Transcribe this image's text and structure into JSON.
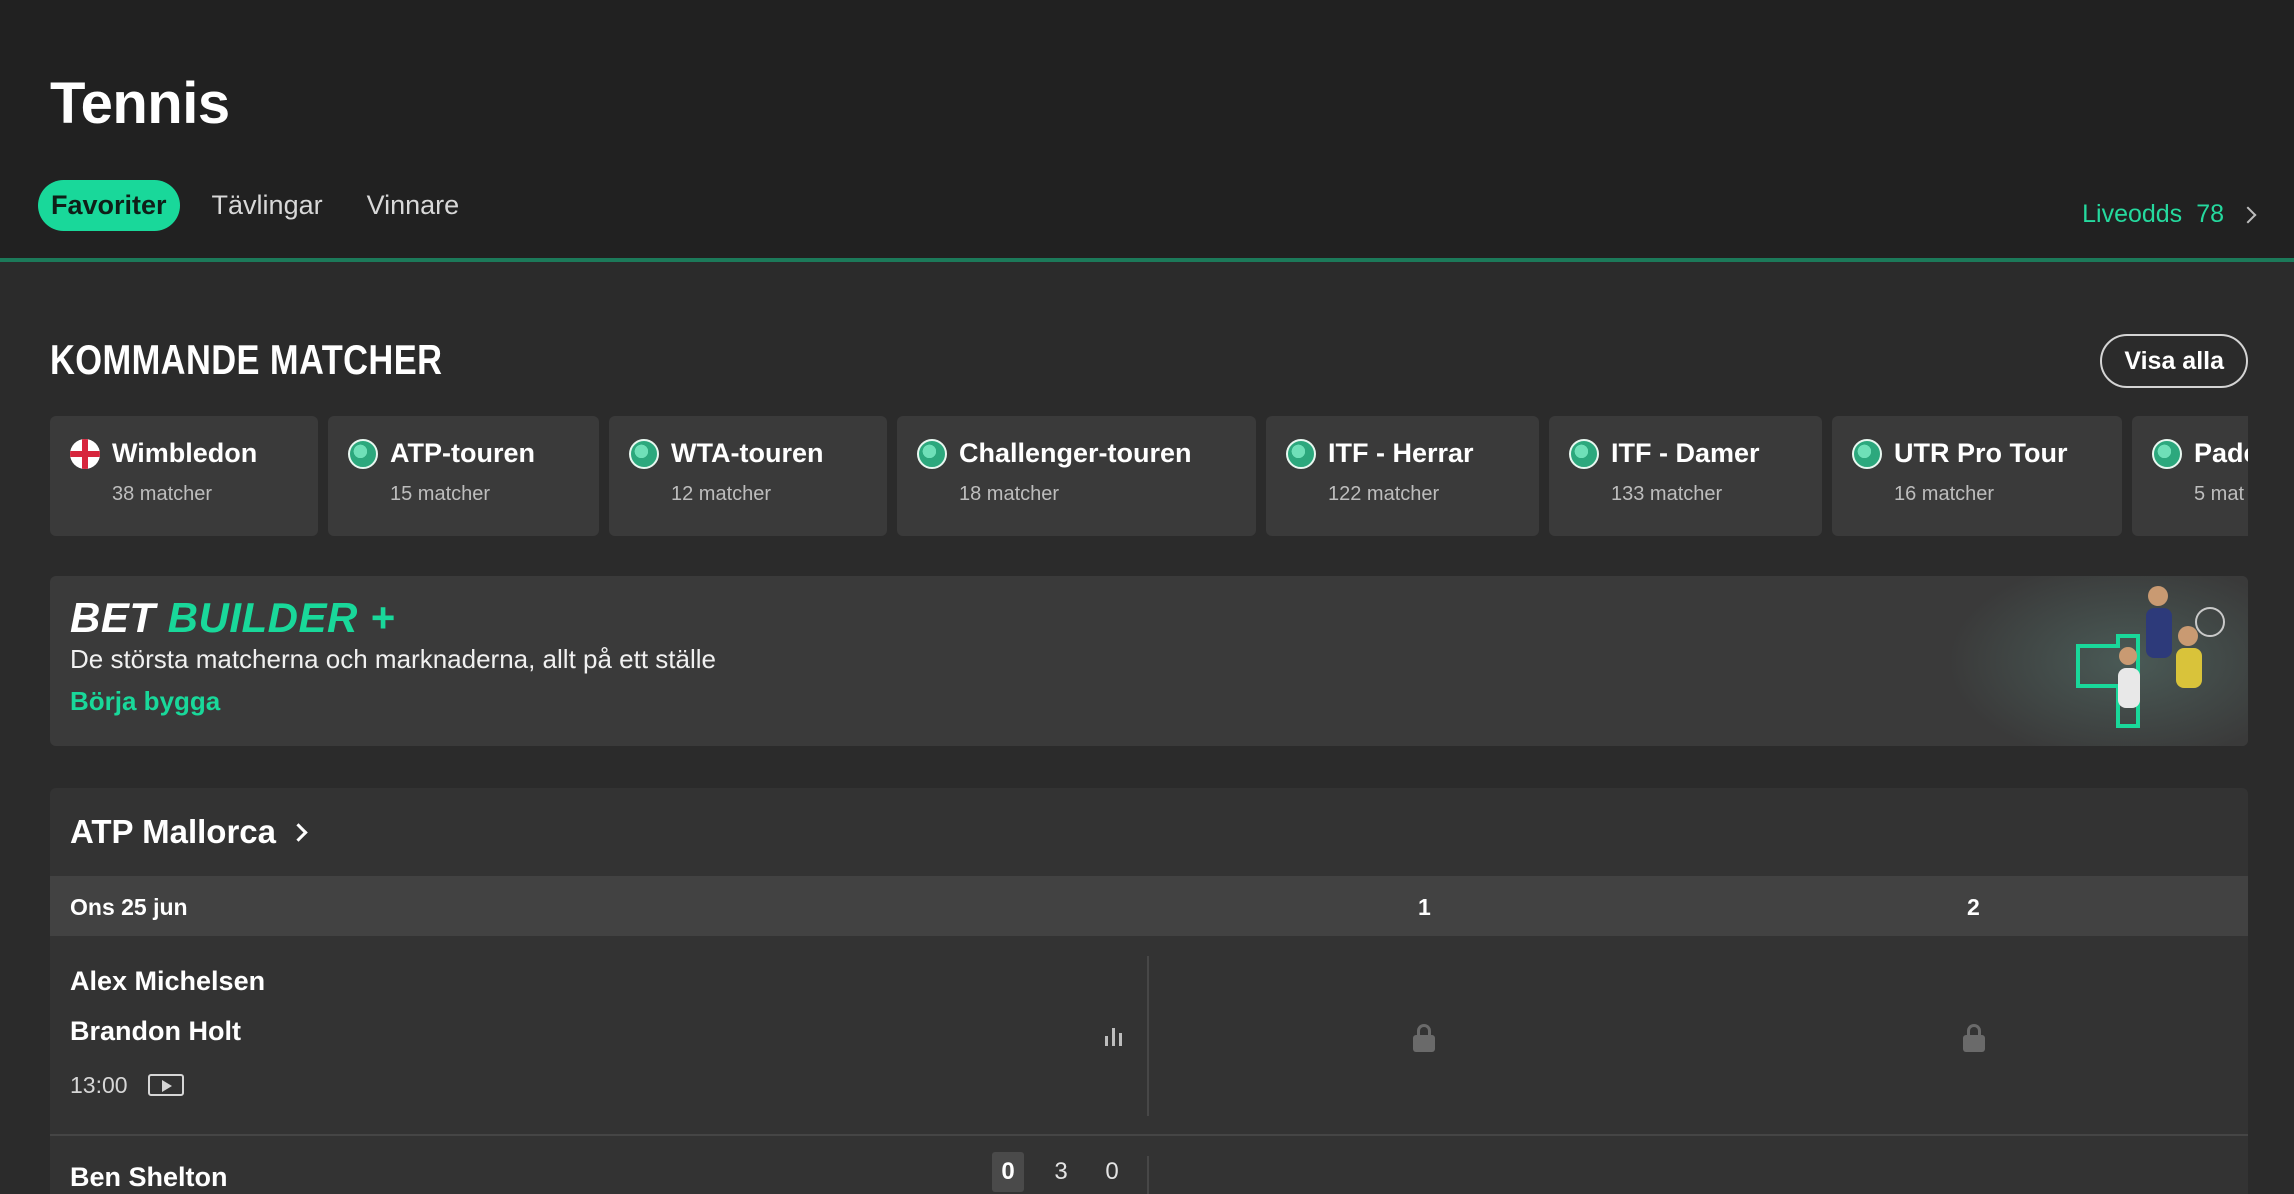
{
  "header": {
    "title": "Tennis",
    "tabs": [
      {
        "label": "Favoriter",
        "active": true
      },
      {
        "label": "Tävlingar",
        "active": false
      },
      {
        "label": "Vinnare",
        "active": false
      }
    ],
    "live_link": {
      "label": "Liveodds",
      "count": "78"
    }
  },
  "upcoming": {
    "title": "KOMMANDE MATCHER",
    "view_all": "Visa alla",
    "competitions": [
      {
        "name": "Wimbledon",
        "count": "38 matcher",
        "icon": "england-flag-icon"
      },
      {
        "name": "ATP-touren",
        "count": "15 matcher",
        "icon": "globe-icon"
      },
      {
        "name": "WTA-touren",
        "count": "12 matcher",
        "icon": "globe-icon"
      },
      {
        "name": "Challenger-touren",
        "count": "18 matcher",
        "icon": "globe-icon"
      },
      {
        "name": "ITF - Herrar",
        "count": "122 matcher",
        "icon": "globe-icon"
      },
      {
        "name": "ITF - Damer",
        "count": "133 matcher",
        "icon": "globe-icon"
      },
      {
        "name": "UTR Pro Tour",
        "count": "16 matcher",
        "icon": "globe-icon"
      },
      {
        "name": "Pade",
        "count": "5 mat",
        "icon": "globe-icon"
      }
    ]
  },
  "banner": {
    "title_part1": "BET",
    "title_part2": "BUILDER +",
    "subtitle": "De största matcherna och marknaderna, allt på ett ställe",
    "cta": "Börja bygga"
  },
  "event": {
    "title": "ATP Mallorca",
    "date": "Ons 25 jun",
    "col1": "1",
    "col2": "2",
    "match1": {
      "player1": "Alex Michelsen",
      "player2": "Brandon Holt",
      "time": "13:00"
    },
    "match2": {
      "player1": "Ben Shelton",
      "scores": [
        "0",
        "3",
        "0"
      ]
    }
  },
  "colors": {
    "accent": "#19d89a",
    "background": "#2b2b2b",
    "header_bg": "#212121"
  }
}
